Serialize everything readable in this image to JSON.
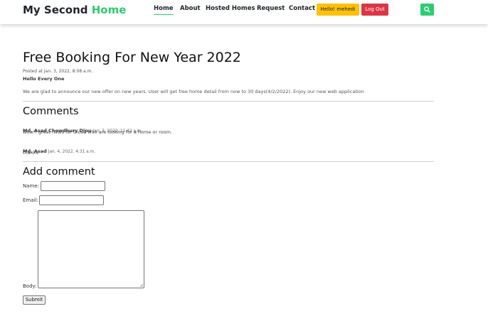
{
  "brand": {
    "part1": "My Second ",
    "part2": "Home"
  },
  "nav": {
    "home": "Home",
    "about": "About",
    "hosted": "Hosted Homes",
    "request": "Request",
    "contact": "Contact"
  },
  "user": {
    "hello": "Hello! mehedi",
    "logout": "Log Out"
  },
  "icons": {
    "search": "search-icon"
  },
  "colors": {
    "brand_accent": "#2ecc71",
    "hello_button": "#ffc107",
    "logout_button": "#dc3545",
    "search_button": "#2ecc71"
  },
  "post": {
    "title": "Free Booking For New Year 2022",
    "date": "Posted at Jan. 3, 2022, 8:08 a.m.",
    "greeting": "Hello Every One",
    "body": "We are glad to announce our new offer on new years. User will get free home detail from now to 30 days(4/2/2022). Enjoy our new web application"
  },
  "comments": {
    "heading": "Comments",
    "items": [
      {
        "author": "Md. Asad Chowdhury Dipu",
        "date": "Jan. 3, 2022, 11:42 a.m.",
        "text": "wow!! great news for those who are looking for a home or room."
      },
      {
        "author": "Md. Asad",
        "date": "Jan. 4, 2022, 4:31 a.m.",
        "text": "thanks"
      }
    ]
  },
  "form": {
    "heading": "Add comment",
    "name_label": "Name:",
    "email_label": "Email:",
    "body_label": "Body:",
    "submit": "Submit"
  }
}
